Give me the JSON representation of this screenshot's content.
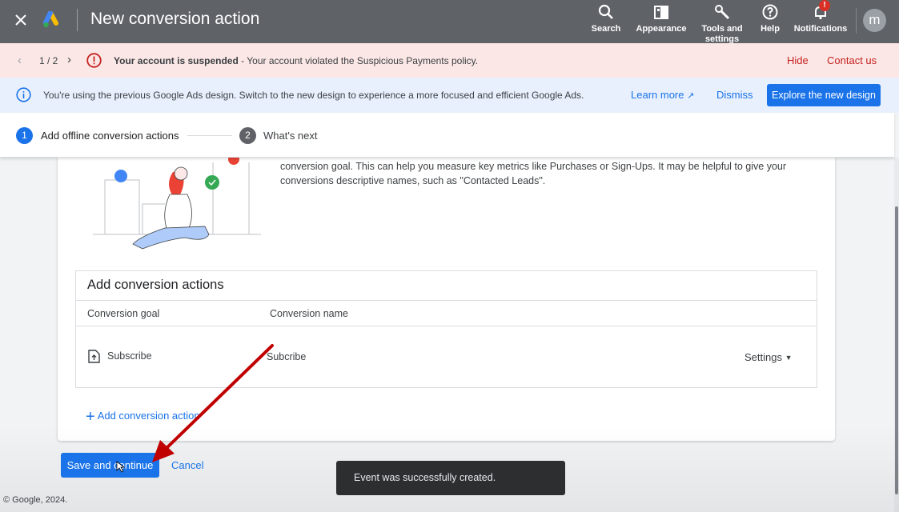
{
  "header": {
    "title": "New conversion action",
    "tools": [
      {
        "label": "Search",
        "icon": "search-icon"
      },
      {
        "label": "Appearance",
        "icon": "appearance-icon"
      },
      {
        "label": "Tools and settings",
        "icon": "wrench-icon"
      },
      {
        "label": "Help",
        "icon": "help-icon"
      },
      {
        "label": "Notifications",
        "icon": "bell-icon",
        "badge": "!"
      }
    ],
    "avatar_letter": "m"
  },
  "suspend_banner": {
    "counter": "1 / 2",
    "bold_text": "Your account is suspended",
    "text": " - Your account violated the Suspicious Payments policy.",
    "hide_label": "Hide",
    "contact_label": "Contact us"
  },
  "info_banner": {
    "text": "You're using the previous Google Ads design. Switch to the new design to experience a more focused and efficient Google Ads.",
    "learn_more": "Learn more",
    "dismiss": "Dismiss",
    "explore": "Explore the new design"
  },
  "stepper": {
    "steps": [
      {
        "num": "1",
        "label": "Add offline conversion actions",
        "active": true
      },
      {
        "num": "2",
        "label": "What's next",
        "active": false
      }
    ]
  },
  "main": {
    "description": "conversion goal. This can help you measure key metrics like Purchases or Sign-Ups. It may be helpful to give your conversions descriptive names, such as \"Contacted Leads\".",
    "table": {
      "heading": "Add conversion actions",
      "columns": [
        "Conversion goal",
        "Conversion name"
      ],
      "rows": [
        {
          "goal": "Subscribe",
          "name": "Subcribe",
          "settings": "Settings"
        }
      ]
    },
    "add_action_label": "Add conversion action"
  },
  "footer": {
    "save_label": "Save and continue",
    "cancel_label": "Cancel",
    "copyright": "© Google, 2024.",
    "toast": "Event was successfully created."
  },
  "colors": {
    "topbar": "#5f6368",
    "primary": "#1a73e8",
    "error": "#c5221f",
    "suspend_bg": "#fbe7e6",
    "info_bg": "#e8f0fe",
    "step_active": "#1a73e8",
    "step_inactive": "#5f6368",
    "annotation_arrow": "#c00000"
  }
}
